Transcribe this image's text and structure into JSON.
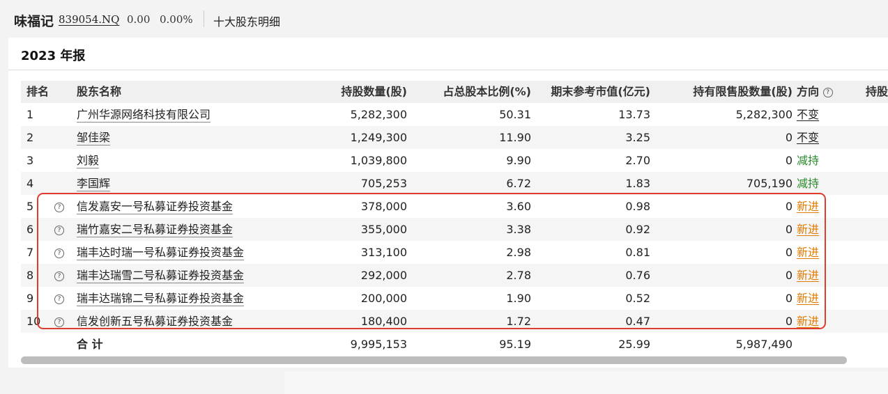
{
  "topbar": {
    "stock_name": "味福记",
    "stock_code": "839054.NQ",
    "price": "0.00",
    "change_pct": "0.00%",
    "page_link": "十大股东明细"
  },
  "section": {
    "title": "2023 年报"
  },
  "table": {
    "headers": {
      "rank": "排名",
      "name": "股东名称",
      "shares": "持股数量(股)",
      "pct": "占总股本比例(%)",
      "value": "期末参考市值(亿元)",
      "restricted": "持有限售股数量(股)",
      "direction": "方向",
      "more": "持股"
    },
    "rows": [
      {
        "rank": "1",
        "name": "广州华源网络科技有限公司",
        "shares": "5,282,300",
        "pct": "50.31",
        "value": "13.73",
        "restricted": "5,282,300",
        "direction": "不变"
      },
      {
        "rank": "2",
        "name": "邹佳梁",
        "shares": "1,249,300",
        "pct": "11.90",
        "value": "3.25",
        "restricted": "0",
        "direction": "不变"
      },
      {
        "rank": "3",
        "name": "刘毅",
        "shares": "1,039,800",
        "pct": "9.90",
        "value": "2.70",
        "restricted": "0",
        "direction": "减持"
      },
      {
        "rank": "4",
        "name": "李国辉",
        "shares": "705,253",
        "pct": "6.72",
        "value": "1.83",
        "restricted": "705,190",
        "direction": "减持"
      },
      {
        "rank": "5",
        "name": "信发嘉安一号私募证券投资基金",
        "shares": "378,000",
        "pct": "3.60",
        "value": "0.98",
        "restricted": "0",
        "direction": "新进"
      },
      {
        "rank": "6",
        "name": "瑞竹嘉安二号私募证券投资基金",
        "shares": "355,000",
        "pct": "3.38",
        "value": "0.92",
        "restricted": "0",
        "direction": "新进"
      },
      {
        "rank": "7",
        "name": "瑞丰达时瑞一号私募证券投资基金",
        "shares": "313,100",
        "pct": "2.98",
        "value": "0.81",
        "restricted": "0",
        "direction": "新进"
      },
      {
        "rank": "8",
        "name": "瑞丰达瑞雪二号私募证券投资基金",
        "shares": "292,000",
        "pct": "2.78",
        "value": "0.76",
        "restricted": "0",
        "direction": "新进"
      },
      {
        "rank": "9",
        "name": "瑞丰达瑞锦二号私募证券投资基金",
        "shares": "200,000",
        "pct": "1.90",
        "value": "0.52",
        "restricted": "0",
        "direction": "新进"
      },
      {
        "rank": "10",
        "name": "信发创新五号私募证券投资基金",
        "shares": "180,400",
        "pct": "1.72",
        "value": "0.47",
        "restricted": "0",
        "direction": "新进"
      }
    ],
    "total": {
      "label": "合 计",
      "shares": "9,995,153",
      "pct": "95.19",
      "value": "25.99",
      "restricted": "5,987,490"
    }
  },
  "icons": {
    "help": "?"
  },
  "colors": {
    "highlight_box": "#e03c2d",
    "direction_down": "#2a8a2a",
    "direction_new": "#e07b00"
  }
}
